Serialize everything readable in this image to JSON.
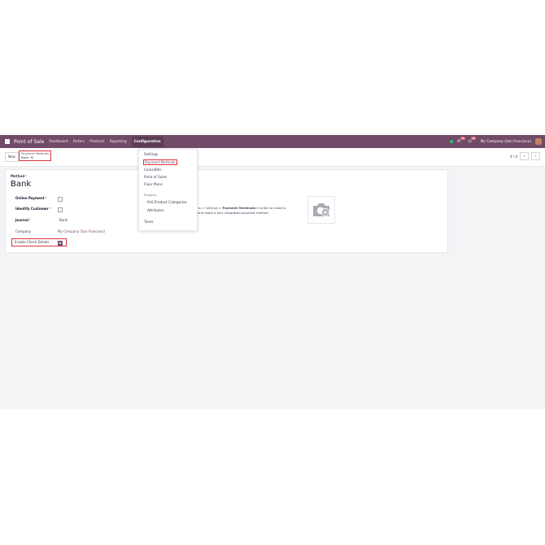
{
  "navbar": {
    "app_title": "Point of Sale",
    "menu": [
      "Dashboard",
      "Orders",
      "Products",
      "Reporting",
      "Configuration"
    ],
    "company": "My Company (San Francisco)",
    "chat_count": "10",
    "activity_count": "34"
  },
  "control_panel": {
    "new_label": "New",
    "breadcrumb_parent": "Payment Methods",
    "breadcrumb_current": "Bank",
    "pager": "4 / 4"
  },
  "form": {
    "method_label": "Method",
    "title": "Bank",
    "online_payment_label": "Online Payment",
    "online_payment_checked": false,
    "identify_customer_label": "Identify Customer",
    "identify_customer_checked": false,
    "journal_label": "Journal",
    "journal_value": "Bank",
    "company_label": "Company",
    "company_value": "My Company (San Francisco)",
    "check_details_label": "Enable Check Details",
    "check_details_checked": true,
    "info_prefix": "ons > ",
    "info_settings": "Settings",
    "info_sep": " > ",
    "info_terminals": "Payment Terminals",
    "info_suffix": " in order to install a",
    "info_line2": "and make a fully integrated payment method."
  },
  "config_menu": {
    "settings": "Settings",
    "payment_methods": "Payment Methods",
    "coins_bills": "Coins/Bills",
    "point_of_sales": "Point of Sales",
    "floor_plans": "Floor Plans",
    "products_header": "Products",
    "pos_categories": "PoS Product Categories",
    "attributes": "Attributes",
    "taxes": "Taxes"
  },
  "colors": {
    "brand": "#714b67",
    "highlight": "#d9363e"
  }
}
